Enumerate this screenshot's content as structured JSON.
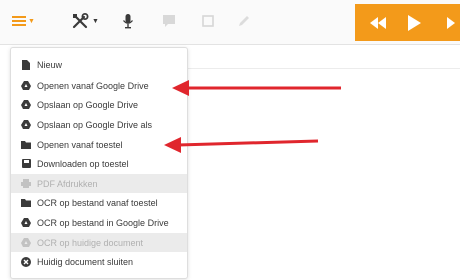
{
  "colors": {
    "accent": "#f39a1a",
    "arrow": "#e0262d",
    "menu_text": "#3a3a3a",
    "disabled_text": "#b0b0b0",
    "disabled_bg": "#ebebeb"
  },
  "toolbar": {
    "menu_button_icon": "hamburger-icon",
    "tools_button_icon": "tools-icon",
    "mic_button_icon": "microphone-icon",
    "comment_button_icon": "comment-icon",
    "box_button_icon": "square-icon",
    "edit_button_icon": "pencil-icon"
  },
  "player": {
    "rewind_icon": "rewind-icon",
    "play_icon": "play-icon",
    "forward_icon": "forward-icon"
  },
  "menu": {
    "items": [
      {
        "label": "Nieuw",
        "icon": "file-icon",
        "disabled": false
      },
      {
        "label": "Openen vanaf Google Drive",
        "icon": "google-drive-icon",
        "disabled": false
      },
      {
        "label": "Opslaan op Google Drive",
        "icon": "google-drive-icon",
        "disabled": false
      },
      {
        "label": "Opslaan op Google Drive als",
        "icon": "google-drive-icon",
        "disabled": false
      },
      {
        "label": "Openen vanaf toestel",
        "icon": "folder-icon",
        "disabled": false
      },
      {
        "label": "Downloaden op toestel",
        "icon": "save-icon",
        "disabled": false
      },
      {
        "label": "PDF Afdrukken",
        "icon": "print-icon",
        "disabled": true
      },
      {
        "label": "OCR op bestand vanaf toestel",
        "icon": "folder-icon",
        "disabled": false
      },
      {
        "label": "OCR op bestand in Google Drive",
        "icon": "google-drive-icon",
        "disabled": false
      },
      {
        "label": "OCR op huidige document",
        "icon": "google-drive-icon",
        "disabled": true
      },
      {
        "label": "Huidig document sluiten",
        "icon": "close-circle-icon",
        "disabled": false
      }
    ]
  },
  "annotations": {
    "arrow_1_target": "Openen vanaf Google Drive",
    "arrow_2_target": "Openen vanaf toestel"
  }
}
